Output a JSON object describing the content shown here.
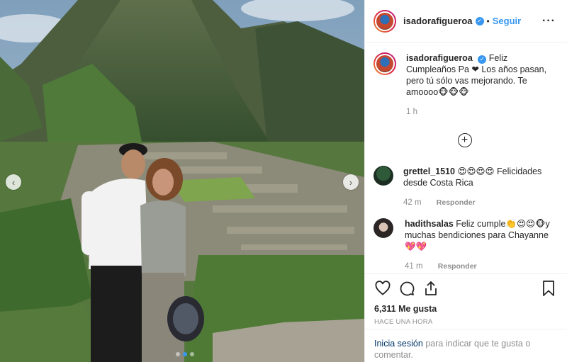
{
  "post": {
    "username": "isadorafigueroa",
    "separator": "•",
    "follow_label": "Seguir",
    "more_icon": "more-options-icon",
    "caption": "Feliz Cumpleaños Pa ❤ Los años pasan, pero tú sólo vas mejorando. Te amoooo🐵🐵🐵",
    "caption_time": "1 h",
    "likes": "6,311 Me gusta",
    "posted_ago": "HACE UNA HORA"
  },
  "comments": [
    {
      "username": "grettel_1510",
      "text": "😍😍😍😍 Felicidades desde Costa Rica",
      "time": "42 m",
      "reply": "Responder"
    },
    {
      "username": "hadithsalas",
      "text": "Feliz cumple👏😍😍🐵y muchas bendiciones para Chayanne💖💖",
      "time": "41 m",
      "reply": "Responder"
    }
  ],
  "login_prompt": {
    "link": "Inicia sesión",
    "rest": " para indicar que te gusta o comentar."
  },
  "colors": {
    "accent": "#3897f0",
    "text": "#262626",
    "muted": "#8e8e8e"
  }
}
